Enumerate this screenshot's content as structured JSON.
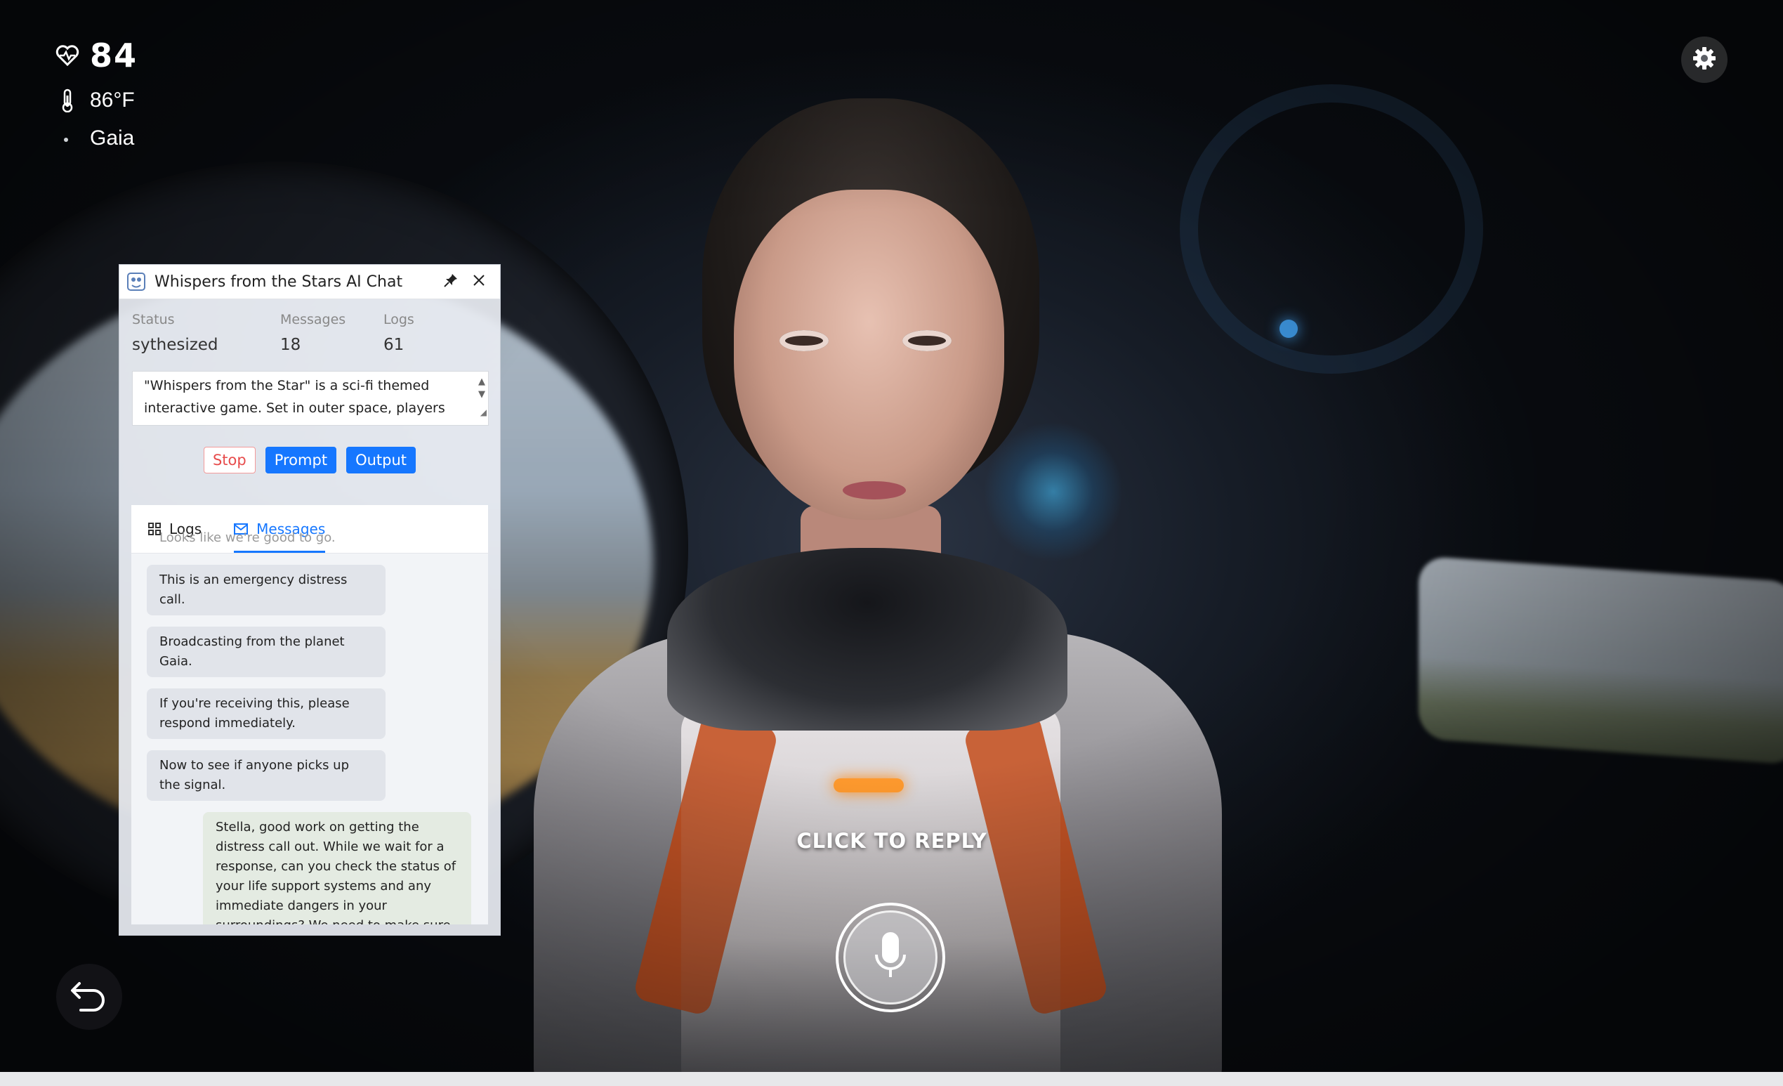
{
  "hud": {
    "heart_rate": "84",
    "temperature": "86°F",
    "location": "Gaia"
  },
  "icons": {
    "heart_rate": "heart-pulse-icon",
    "temperature": "thermometer-icon",
    "location": "dot-icon",
    "settings": "gear-icon",
    "back": "undo-arrow-icon",
    "mic": "microphone-icon"
  },
  "reply": {
    "label": "CLICK TO REPLY"
  },
  "panel": {
    "title": "Whispers from the Stars AI Chat",
    "stats": [
      {
        "label": "Status",
        "value": "sythesized"
      },
      {
        "label": "Messages",
        "value": "18"
      },
      {
        "label": "Logs",
        "value": "61"
      }
    ],
    "description": "\"Whispers from the Star\" is a sci-fi themed interactive game. Set in outer space, players",
    "buttons": {
      "stop": "Stop",
      "prompt": "Prompt",
      "output": "Output"
    },
    "tabs": [
      {
        "label": "Logs",
        "active": false
      },
      {
        "label": "Messages",
        "active": true
      }
    ],
    "ghost_text": "Looks like we're good to go.",
    "messages": [
      {
        "from": "assistant",
        "text": "This is an emergency distress call."
      },
      {
        "from": "assistant",
        "text": "Broadcasting from the planet Gaia."
      },
      {
        "from": "assistant",
        "text": "If you're receiving this, please respond immediately."
      },
      {
        "from": "assistant",
        "text": "Now to see if anyone picks up the signal."
      },
      {
        "from": "user",
        "text": "Stella, good work on getting the distress call out. While we wait for a response, can you check the status of your life support systems and any immediate dangers in your surroundings? We need to make sure you're safe until help arrives."
      }
    ]
  },
  "colors": {
    "accent": "#1677ff",
    "stop": "#e74c4c",
    "suit_light": "#ff9a2e"
  }
}
